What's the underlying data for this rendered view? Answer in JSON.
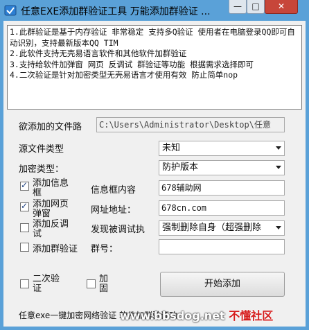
{
  "window": {
    "title": "任意EXE添加群验证工具  万能添加群验证 ...",
    "minimize": "—",
    "maximize": "□",
    "close": "✕"
  },
  "memo": {
    "text": "1.此群验证是基于内存验证 非常稳定 支持多Q验证 使用者在电脑登录QQ即可自动识别，支持最新版本QQ TIM\n2.此软件支持无壳易语言软件和其他软件加群验证\n3.支持给软件加弹窗 网页 反调试 群验证等功能 根据需求选择即可\n4.二次验证是针对加密类型无壳易语言才使用有效 防止简单nop"
  },
  "form": {
    "file_label": "欲添加的文件路",
    "file_value": "C:\\Users\\Administrator\\Desktop\\任意",
    "source_type_label": "源文件类型",
    "source_type_value": "未知",
    "encrypt_type_label": "加密类型：",
    "encrypt_type_value": "防护版本",
    "add_info_label": "添加信息框",
    "add_info_checked": true,
    "info_content_label": "信息框内容",
    "info_content_value": "678辅助网",
    "add_popup_label": "添加网页弹窗",
    "add_popup_checked": true,
    "url_label": "网址地址：",
    "url_value": "678cn.com",
    "add_antidebug_label": "添加反调试",
    "add_antidebug_checked": false,
    "debug_found_label": "发现被调试执",
    "debug_found_value": "强制删除自身（超强删除",
    "add_group_label": "添加群验证",
    "add_group_checked": false,
    "group_no_label": "群号：",
    "group_no_value": "",
    "second_verify_label": "二次验证",
    "second_verify_checked": false,
    "reinforce_label": "加固",
    "reinforce_checked": false,
    "start_button": "开始添加"
  },
  "status": {
    "text": "任意exe一键加密网络验证 软件加群验证功"
  },
  "watermark": {
    "url": "www.bbsdog.net",
    "brand": "不懂社区"
  }
}
